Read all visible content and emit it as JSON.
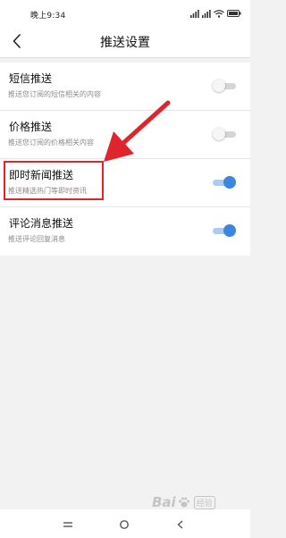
{
  "status_bar": {
    "time": "晚上9:34",
    "icons": [
      "signal-icon",
      "signal-icon",
      "wifi-icon",
      "battery-icon"
    ]
  },
  "header": {
    "title": "推送设置",
    "back_icon": "chevron-left-icon"
  },
  "settings": [
    {
      "title": "短信推送",
      "description": "推送您订阅的短信相关的内容",
      "enabled": false
    },
    {
      "title": "价格推送",
      "description": "推送您订阅的价格相关内容",
      "enabled": false
    },
    {
      "title": "即时新闻推送",
      "description": "推送精选热门等即时资讯",
      "enabled": true
    },
    {
      "title": "评论消息推送",
      "description": "推送评论回复消息",
      "enabled": true
    }
  ],
  "annotation": {
    "color": "#e0242b",
    "highlighted_item": "即时新闻推送"
  },
  "colors": {
    "toggle_on": "#3b86e0",
    "toggle_on_track": "#a9ccf2",
    "toggle_off": "#d5d5d5"
  },
  "watermark": {
    "text": "Bai",
    "sub": "经验"
  },
  "navbar": {
    "icons": [
      "menu-icon",
      "home-icon",
      "back-icon"
    ]
  }
}
